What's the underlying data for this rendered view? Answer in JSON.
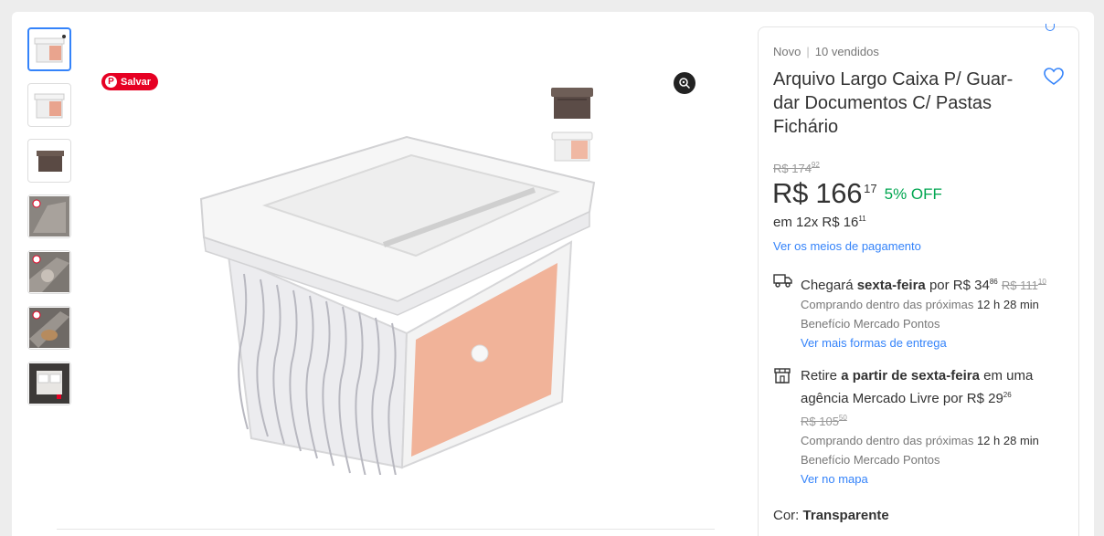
{
  "thumbnails": [
    {
      "name": "thumb-transparent-box"
    },
    {
      "name": "thumb-transparent-box-2"
    },
    {
      "name": "thumb-brown-box"
    },
    {
      "name": "thumb-detail-1"
    },
    {
      "name": "thumb-detail-2"
    },
    {
      "name": "thumb-detail-3"
    },
    {
      "name": "thumb-detail-4"
    }
  ],
  "gallery": {
    "pin_label": "Salvar",
    "pin_logo": "P"
  },
  "product": {
    "condition": "Novo",
    "sold": "10 vendidos",
    "title": "Arquivo Largo Caixa P/ Guar-dar Documentos C/ Pastas Fichário",
    "old_price": "R$ 174",
    "old_price_cents": "92",
    "price": "R$ 166",
    "price_cents": "17",
    "discount": "5% OFF",
    "installments": "em 12x R$ 16",
    "installments_cents": "11",
    "payment_link": "Ver os meios de pagamento"
  },
  "shipping": {
    "arrive_prefix": "Chegará",
    "arrive_day": "sexta-feira",
    "arrive_price_prefix": "por R$ 34",
    "arrive_price_cents": "86",
    "arrive_old": "R$ 111",
    "arrive_old_cents": "10",
    "buy_within": "Comprando dentro das próximas",
    "time_left": "12 h 28 min",
    "benefit": "Benefício Mercado Pontos",
    "more_link": "Ver mais formas de entrega"
  },
  "pickup": {
    "prefix": "Retire",
    "from_text": "a partir de sexta-feira",
    "suffix": "em uma agência Mercado Livre por R$ 29",
    "price_cents": "26",
    "old": "R$ 105",
    "old_cents": "50",
    "buy_within": "Comprando dentro das próximas",
    "time_left": "12 h 28 min",
    "benefit": "Benefício Mercado Pontos",
    "map_link": "Ver no mapa"
  },
  "color": {
    "label": "Cor:",
    "value": "Transparente"
  },
  "colors": {
    "accent": "#3483fa",
    "green": "#00a650",
    "pinterest": "#e60023"
  }
}
